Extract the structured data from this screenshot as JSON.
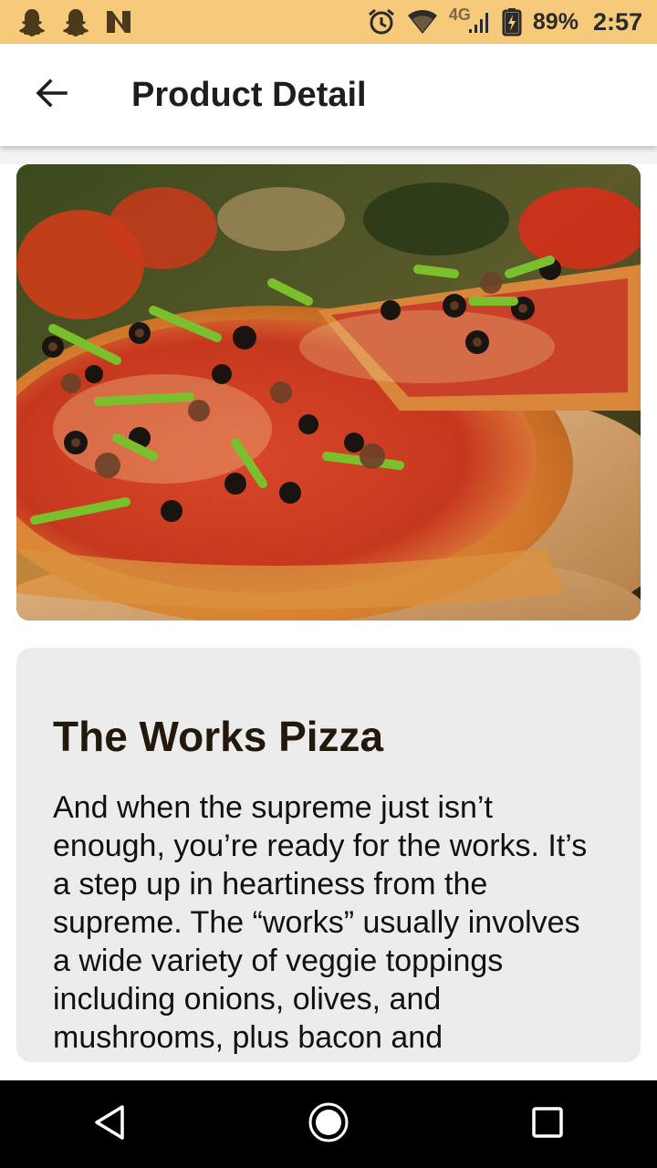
{
  "status_bar": {
    "notification_icons": [
      "snapchat-icon",
      "snapchat-icon",
      "n-app-icon"
    ],
    "network_label": "4G",
    "battery_percent": "89%",
    "time": "2:57"
  },
  "app_bar": {
    "title": "Product Detail",
    "back_icon": "arrow-back-icon"
  },
  "product": {
    "name": "The Works Pizza",
    "description": "And when the supreme just isn’t enough, you’re ready for the works. It’s a step up in heartiness from the supreme. The “works” usually involves a wide variety of veggie toppings including onions, olives, and mushrooms, plus bacon and"
  },
  "colors": {
    "status_bar_bg": "#f7c97a",
    "card_bg": "#ececec",
    "title_text": "#22190c"
  }
}
